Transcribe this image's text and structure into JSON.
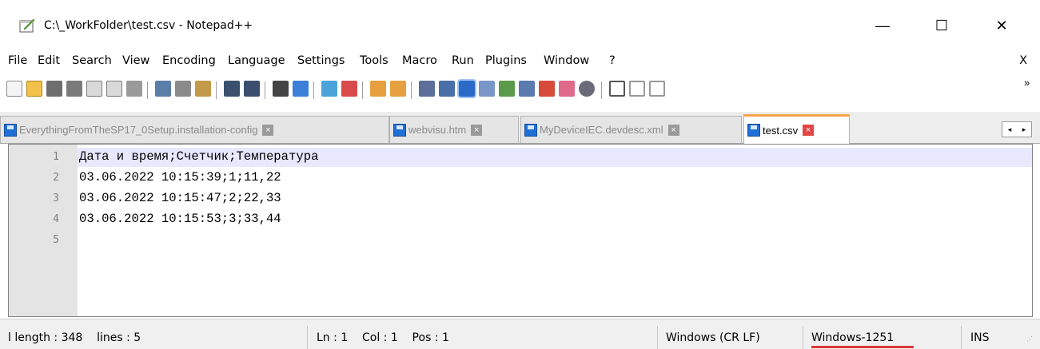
{
  "window": {
    "title": "C:\\_WorkFolder\\test.csv - Notepad++",
    "app_icon": "notepadpp-icon",
    "minimize_glyph": "—",
    "maximize_glyph": "☐",
    "close_glyph": "✕"
  },
  "menu": {
    "items": [
      "File",
      "Edit",
      "Search",
      "View",
      "Encoding",
      "Language",
      "Settings",
      "Tools",
      "Macro",
      "Run",
      "Plugins",
      "Window",
      "?"
    ],
    "close_label": "X"
  },
  "toolbar": {
    "icons": [
      "new-file-icon",
      "open-file-icon",
      "save-icon",
      "save-all-icon",
      "close-icon",
      "close-all-icon",
      "print-icon",
      "cut-icon",
      "copy-icon",
      "paste-icon",
      "undo-icon",
      "redo-icon",
      "find-icon",
      "replace-icon",
      "zoom-in-icon",
      "zoom-out-icon",
      "sync-vertical-icon",
      "sync-horizontal-icon",
      "word-wrap-icon",
      "all-chars-icon",
      "indent-guide-icon",
      "udl-icon",
      "doc-map-icon",
      "function-list-icon",
      "folder-workspace-icon",
      "document-list-icon",
      "monitoring-icon",
      "record-macro-icon",
      "stop-macro-icon",
      "play-macro-icon"
    ],
    "overflow_glyph": "»"
  },
  "tabs": [
    {
      "label": "EverythingFromTheSP17_0Setup.installation-config",
      "active": false
    },
    {
      "label": "webvisu.htm",
      "active": false
    },
    {
      "label": "MyDeviceIEC.devdesc.xml",
      "active": false
    },
    {
      "label": "test.csv",
      "active": true
    }
  ],
  "tab_scroll": {
    "left": "◂",
    "right": "▸"
  },
  "editor": {
    "line_numbers": [
      "1",
      "2",
      "3",
      "4",
      "5"
    ],
    "lines": [
      "Дата и время;Счетчик;Температура",
      "03.06.2022 10:15:39;1;11,22",
      "03.06.2022 10:15:47;2;22,33",
      "03.06.2022 10:15:53;3;33,44",
      ""
    ],
    "current_line": 1
  },
  "status": {
    "length_lines": "l length : 348    lines : 5",
    "position": "Ln : 1    Col : 1    Pos : 1",
    "eol": "Windows (CR LF)",
    "encoding": "Windows-1251",
    "mode": "INS"
  },
  "colors": {
    "active_tab_accent": "#f7a34a",
    "tab_close_active": "#e04646",
    "current_line_bg": "#e8e8ff",
    "gutter_bg": "#e4e4e4",
    "encoding_underline": "#d93a3a"
  }
}
